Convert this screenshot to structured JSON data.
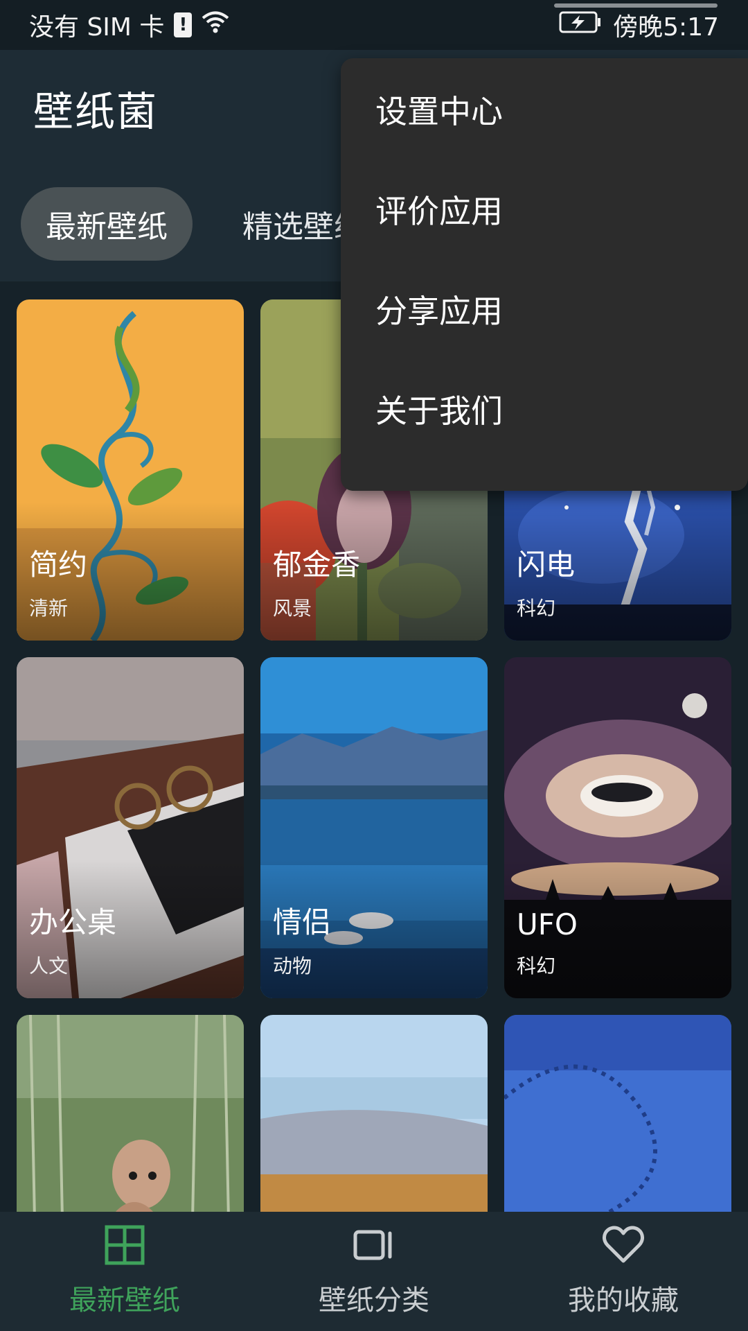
{
  "status_bar": {
    "carrier": "没有 SIM 卡",
    "alert_glyph": "!",
    "time": "傍晚5:17"
  },
  "app": {
    "title": "壁纸菌"
  },
  "tabs": [
    {
      "label": "最新壁纸",
      "active": true
    },
    {
      "label": "精选壁纸",
      "active": false
    }
  ],
  "wallpapers": [
    {
      "title": "简约",
      "category": "清新"
    },
    {
      "title": "郁金香",
      "category": "风景"
    },
    {
      "title": "闪电",
      "category": "科幻"
    },
    {
      "title": "办公桌",
      "category": "人文"
    },
    {
      "title": "情侣",
      "category": "动物"
    },
    {
      "title": "UFO",
      "category": "科幻"
    },
    {
      "title": "",
      "category": ""
    },
    {
      "title": "",
      "category": ""
    },
    {
      "title": "",
      "category": ""
    }
  ],
  "overflow_menu": {
    "items": [
      {
        "label": "设置中心"
      },
      {
        "label": "评价应用"
      },
      {
        "label": "分享应用"
      },
      {
        "label": "关于我们"
      }
    ]
  },
  "bottom_nav": [
    {
      "label": "最新壁纸",
      "icon": "grid-icon",
      "active": true
    },
    {
      "label": "壁纸分类",
      "icon": "category-icon",
      "active": false
    },
    {
      "label": "我的收藏",
      "icon": "heart-icon",
      "active": false
    }
  ],
  "colors": {
    "accent_green": "#3fa35b",
    "menu_bg": "#2c2c2c",
    "appbar_bg": "#1e2c35",
    "page_bg": "#162229"
  }
}
